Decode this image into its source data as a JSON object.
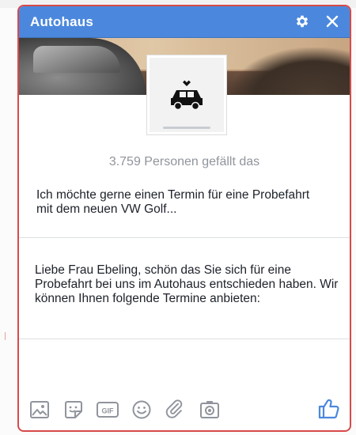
{
  "window": {
    "title": "Autohaus",
    "title_icons": [
      "gear-icon",
      "close-icon"
    ]
  },
  "page": {
    "likes_text": "3.759 Personen gefällt das",
    "profile_icon": "taxi-car-icon"
  },
  "messages": [
    {
      "direction": "incoming",
      "text": "Ich möchte gerne einen Termin für eine Probefahrt mit dem neuen VW Golf..."
    },
    {
      "direction": "outgoing",
      "text": "Liebe Frau Ebeling, schön das Sie sich für eine Probefahrt bei uns im Autohaus entschieden haben. Wir können Ihnen folgende Termine anbieten:"
    }
  ],
  "composer": {
    "tools": [
      "image-icon",
      "sticker-icon",
      "gif-icon",
      "emoji-icon",
      "attach-icon",
      "camera-icon"
    ],
    "send_icon": "thumbs-up-icon"
  },
  "colors": {
    "header": "#4b88dd",
    "border": "#d84a4a",
    "icon": "#90949c",
    "like": "#4b88dd"
  }
}
